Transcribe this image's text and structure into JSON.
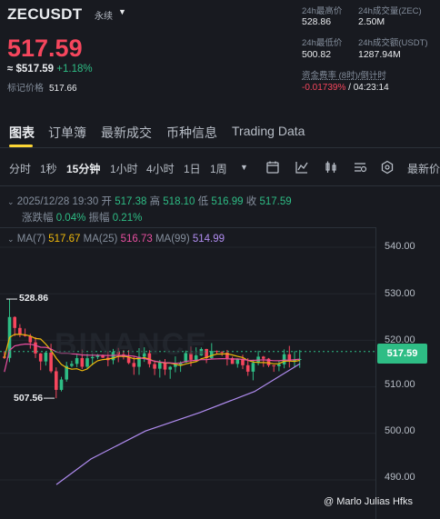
{
  "header": {
    "symbol": "ZECUSDT",
    "contract_type": "永续",
    "last_price": "517.59",
    "usd_price": "≈ $517.59",
    "change_pct": "+1.18%",
    "mark_label": "标记价格",
    "mark_price": "517.66",
    "stats": {
      "high_label": "24h最高价",
      "high_value": "528.86",
      "vol_zec_label": "24h成交量(ZEC)",
      "vol_zec_value": "2.50M",
      "low_label": "24h最低价",
      "low_value": "500.82",
      "vol_usdt_label": "24h成交额(USDT)",
      "vol_usdt_value": "1287.94M",
      "funding_label": "资金费率 (8时)/倒计时",
      "funding_rate": "-0.01739%",
      "funding_sep": "/",
      "countdown": "04:23:14"
    }
  },
  "tabs": [
    "图表",
    "订单簿",
    "最新成交",
    "币种信息",
    "Trading Data"
  ],
  "intervals": [
    "分时",
    "1秒",
    "15分钟",
    "1小时",
    "4小时",
    "1日",
    "1周"
  ],
  "active_interval": "15分钟",
  "latest_label": "最新价",
  "chart": {
    "datetime": "2025/12/28 19:30",
    "open_label": "开",
    "open": "517.38",
    "high_label": "高",
    "high": "518.10",
    "low_label": "低",
    "low": "516.99",
    "close_label": "收",
    "close": "517.59",
    "change_label": "涨跌幅",
    "change": "0.04%",
    "amp_label": "振幅",
    "amp": "0.21%",
    "ma7_label": "MA(7)",
    "ma7": "517.67",
    "ma25_label": "MA(25)",
    "ma25": "516.73",
    "ma99_label": "MA(99)",
    "ma99": "514.99",
    "high_marker": "528.86",
    "low_marker": "507.56",
    "watermark": "BINANCE",
    "credit": "@ Marlo Julias Hfks",
    "current_price_label": "517.59",
    "y_ticks": [
      "540.00",
      "530.00",
      "520.00",
      "510.00",
      "500.00",
      "490.00"
    ],
    "colors": {
      "up": "#2ebd85",
      "down": "#f6465d",
      "ma7": "#f0b90b",
      "ma25": "#e84fa0",
      "ma99": "#b08cf0"
    }
  }
}
